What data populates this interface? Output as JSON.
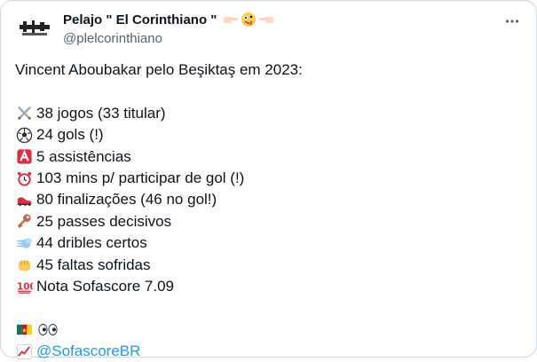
{
  "author": {
    "display_name": "Pelajo \" El Corinthiano \"",
    "handle": "@plelcorinthiano",
    "name_emojis": [
      "pointing-right-icon",
      "zany-face-icon",
      "pointing-left-icon"
    ]
  },
  "tweet": {
    "intro": "Vincent Aboubakar pelo Beşiktaş em 2023:",
    "stats": [
      {
        "icon": "crossed-swords-icon",
        "text": "38 jogos (33 titular)"
      },
      {
        "icon": "soccer-ball-icon",
        "text": "24 gols (!)"
      },
      {
        "icon": "letter-a-button-icon",
        "text": "5 assistências"
      },
      {
        "icon": "alarm-clock-icon",
        "text": "103 mins p/ participar de gol (!)"
      },
      {
        "icon": "cleat-icon",
        "text": "80 finalizações (46 no gol!)"
      },
      {
        "icon": "key-icon",
        "text": "25 passes decisivos"
      },
      {
        "icon": "dash-icon",
        "text": "44 dribles certos"
      },
      {
        "icon": "fist-icon",
        "text": "45 faltas sofridas"
      },
      {
        "icon": "hundred-points-icon",
        "text": "Nota Sofascore 7.09"
      }
    ],
    "footer_emojis": [
      "cameroon-flag-icon",
      "eyes-icon"
    ],
    "source_icon": "chart-increasing-icon",
    "source_mention": "@SofascoreBR"
  },
  "colors": {
    "text": "#0f1419",
    "secondary": "#536471",
    "link": "#1d9bf0",
    "border": "#cfd9de"
  }
}
